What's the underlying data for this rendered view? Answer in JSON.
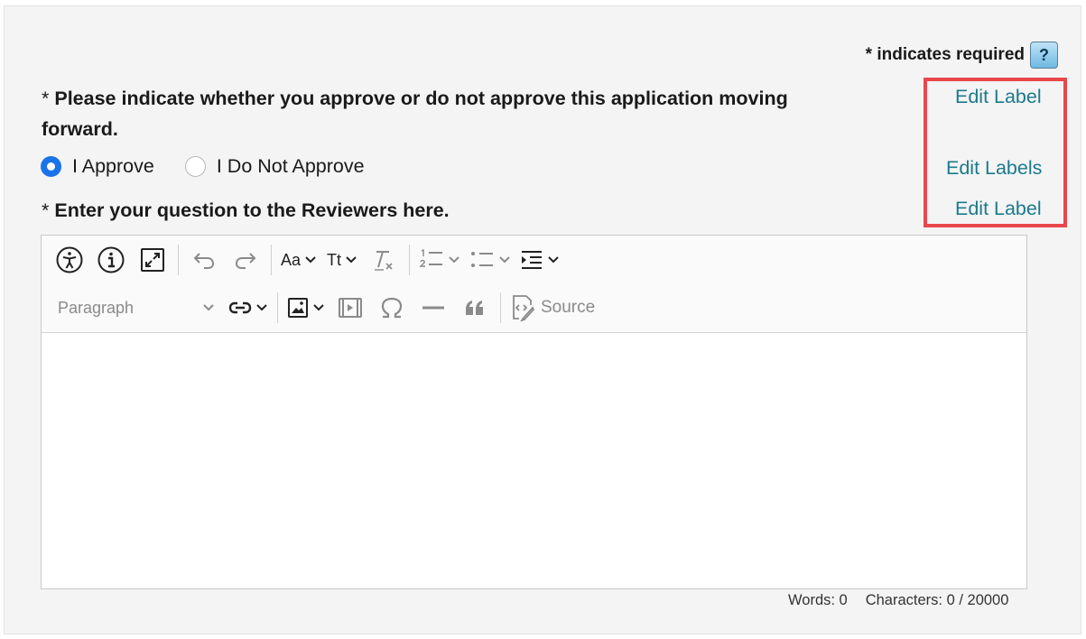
{
  "form": {
    "required_note": "* indicates required",
    "help_label": "?",
    "question1": {
      "star": "*",
      "text": "Please indicate whether you approve or do not approve this application moving forward."
    },
    "radio_options": [
      {
        "label": "I Approve",
        "checked": true
      },
      {
        "label": "I Do Not Approve",
        "checked": false
      }
    ],
    "question2": {
      "star": "*",
      "text": "Enter your question to the Reviewers here."
    },
    "edit_links": [
      "Edit Label",
      "Edit Labels",
      "Edit Label"
    ],
    "highlight_color": "#e8474c",
    "link_color": "#1b7a8c",
    "accent_color": "#1a73e8"
  },
  "editor": {
    "toolbar_row1": [
      {
        "icon": "accessibility-icon"
      },
      {
        "icon": "info-icon"
      },
      {
        "icon": "fullscreen-icon"
      },
      {
        "icon": "undo-icon"
      },
      {
        "icon": "redo-icon"
      },
      {
        "icon": "font-family-icon",
        "label": "Aa"
      },
      {
        "icon": "font-size-icon",
        "label": "Tt"
      },
      {
        "icon": "remove-format-icon"
      },
      {
        "icon": "numbered-list-icon"
      },
      {
        "icon": "bulleted-list-icon"
      },
      {
        "icon": "indent-icon"
      }
    ],
    "paragraph_label": "Paragraph",
    "source_label": "Source",
    "words_label": "Words: 0",
    "characters_label": "Characters: 0 / 20000"
  }
}
